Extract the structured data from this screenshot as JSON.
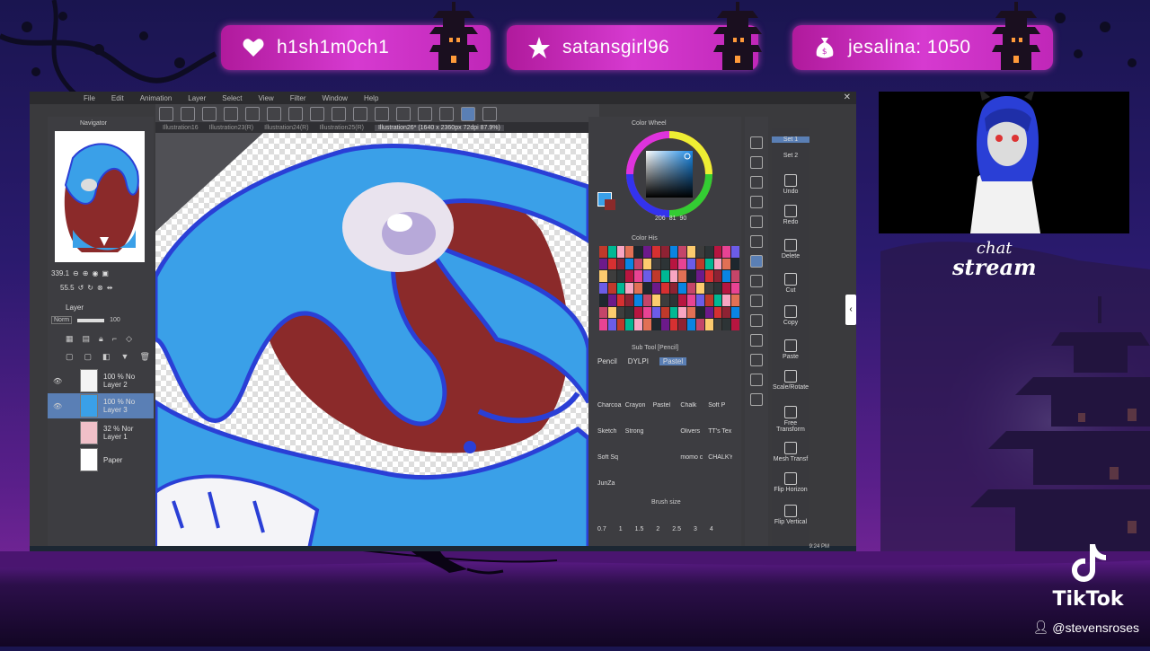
{
  "alerts": [
    {
      "icon": "heart-icon",
      "text": "h1sh1m0ch1"
    },
    {
      "icon": "star-icon",
      "text": "satansgirl96"
    },
    {
      "icon": "money-bag-icon",
      "text": "jesalina: 1050"
    }
  ],
  "app": {
    "menu": [
      "File",
      "Edit",
      "Animation",
      "Layer",
      "Select",
      "View",
      "Filter",
      "Window",
      "Help"
    ],
    "tabs": [
      "Illustration16",
      "Illustration23(R)",
      "Illustration24(R)",
      "Illustration25(R)",
      "Illustration26* (1640 x 2360px 72dpi 87.9%)"
    ],
    "navigator": {
      "title": "Navigator",
      "zoom": "339.1",
      "angle": "55.5"
    },
    "layers": {
      "title": "Layer",
      "blend": "Norm",
      "opacity": "100",
      "items": [
        {
          "pct": "100 %",
          "mode": "No",
          "name": "Layer 2"
        },
        {
          "pct": "100 %",
          "mode": "No",
          "name": "Layer 3"
        },
        {
          "pct": "32 %",
          "mode": "Nor",
          "name": "Layer 1"
        },
        {
          "pct": "",
          "mode": "",
          "name": "Paper"
        }
      ]
    },
    "color_wheel": {
      "title": "Color Wheel",
      "h": "206",
      "s": "81",
      "v": "90"
    },
    "color_history": {
      "title": "Color His"
    },
    "sub_tool": {
      "title": "Sub Tool [Pencil]",
      "tabs": [
        "Pencil",
        "DYLPI",
        "Pastel"
      ],
      "brushes": [
        [
          "Charcoa",
          "Crayon",
          "Pastel",
          "Chalk",
          "Soft P"
        ],
        [
          "Sketch",
          "Strong",
          "",
          "Olivers",
          "TT's Tex"
        ],
        [
          "Soft Sq",
          "",
          "",
          "momo c",
          "CHALKY"
        ],
        [
          "JunZa",
          "",
          "",
          "",
          ""
        ]
      ]
    },
    "brush_size": {
      "title": "Brush size",
      "values": [
        "0.7",
        "1",
        "1.5",
        "2",
        "2.5",
        "3",
        "4"
      ]
    },
    "commands": [
      "Set 1",
      "Set 2",
      "Undo",
      "Redo",
      "Delete",
      "Cut",
      "Copy",
      "Paste",
      "Scale/Rotate",
      "Free Transform",
      "Mesh Transf",
      "Flip Horizon",
      "Flip Vertical"
    ],
    "clock": "9:24 PM"
  },
  "overlay": {
    "chat_line1": "chat",
    "chat_line2": "stream",
    "brand": "TikTok",
    "handle": "@stevensroses"
  },
  "colors": {
    "alert_pink": "#d63ad0",
    "main_blue": "#3aa0e8",
    "main_maroon": "#8b2a2a",
    "outline_blue": "#2a3fd6"
  }
}
